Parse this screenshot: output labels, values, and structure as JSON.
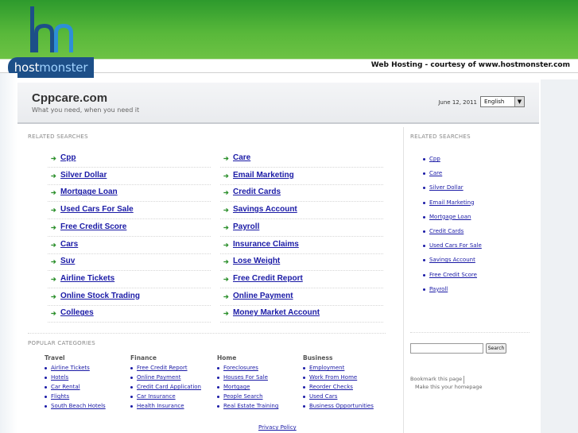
{
  "header": {
    "logo_text_host": "host",
    "logo_text_monster": "monster",
    "courtesy": "Web Hosting - courtesy of www.hostmonster.com"
  },
  "site": {
    "title": "Cppcare.com",
    "tagline": "What you need, when you need it",
    "date": "June 12, 2011",
    "language": "English"
  },
  "main": {
    "section_label": "RELATED SEARCHES",
    "left_links": [
      "Cpp",
      "Silver Dollar",
      "Mortgage Loan",
      "Used Cars For Sale",
      "Free Credit Score",
      "Cars",
      "Suv",
      "Airline Tickets",
      "Online Stock Trading",
      "Colleges"
    ],
    "right_links": [
      "Care",
      "Email Marketing",
      "Credit Cards",
      "Savings Account",
      "Payroll",
      "Insurance Claims",
      "Lose Weight",
      "Free Credit Report",
      "Online Payment",
      "Money Market Account"
    ]
  },
  "sidebar": {
    "section_label": "RELATED SEARCHES",
    "links": [
      "Cpp",
      "Care",
      "Silver Dollar",
      "Email Marketing",
      "Mortgage Loan",
      "Credit Cards",
      "Used Cars For Sale",
      "Savings Account",
      "Free Credit Score",
      "Payroll"
    ],
    "search_button": "Search",
    "bookmark": "Bookmark this page",
    "homepage": "Make this your homepage"
  },
  "popular": {
    "section_label": "POPULAR CATEGORIES",
    "columns": [
      {
        "heading": "Travel",
        "items": [
          "Airline Tickets",
          "Hotels",
          "Car Rental",
          "Flights",
          "South Beach Hotels"
        ]
      },
      {
        "heading": "Finance",
        "items": [
          "Free Credit Report",
          "Online Payment",
          "Credit Card Application",
          "Car Insurance",
          "Health Insurance"
        ]
      },
      {
        "heading": "Home",
        "items": [
          "Foreclosures",
          "Houses For Sale",
          "Mortgage",
          "People Search",
          "Real Estate Training"
        ]
      },
      {
        "heading": "Business",
        "items": [
          "Employment",
          "Work From Home",
          "Reorder Checks",
          "Used Cars",
          "Business Opportunities"
        ]
      }
    ]
  },
  "footer": {
    "privacy": "Privacy Policy"
  },
  "colors": {
    "link": "#1a1aa6",
    "arrow": "#2b8f2b",
    "header_green": "#58b83a",
    "logo_blue": "#1d4f88"
  }
}
